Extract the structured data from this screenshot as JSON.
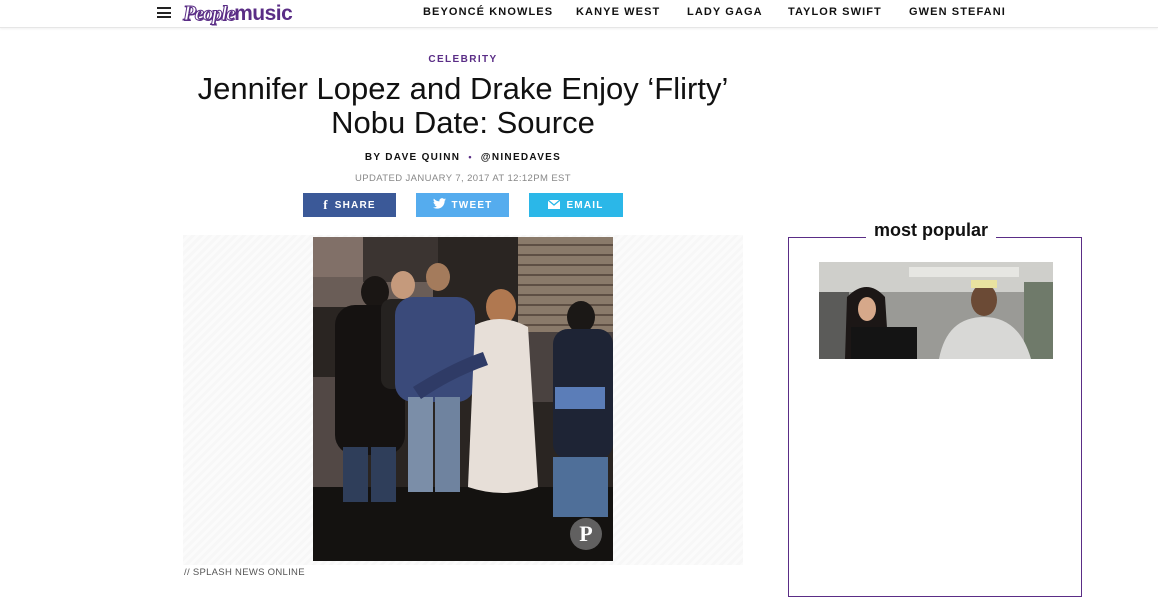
{
  "header": {
    "logo_people": "People",
    "logo_music": "music",
    "nav": [
      {
        "label": "BEYONCÉ KNOWLES"
      },
      {
        "label": "KANYE WEST"
      },
      {
        "label": "LADY GAGA"
      },
      {
        "label": "TAYLOR SWIFT"
      },
      {
        "label": "GWEN STEFANI"
      }
    ]
  },
  "article": {
    "kicker": "CELEBRITY",
    "title_line1": "Jennifer Lopez and Drake Enjoy ‘Flirty’",
    "title_line2": "Nobu Date: Source",
    "byline": {
      "author": "BY DAVE QUINN",
      "separator": "•",
      "handle": "@NINEDAVES"
    },
    "updated": "UPDATED JANUARY 7, 2017 AT 12:12PM EST",
    "share": [
      {
        "label": "SHARE",
        "icon": "facebook-icon",
        "color": "#3b5998"
      },
      {
        "label": "TWEET",
        "icon": "twitter-icon",
        "color": "#55acee"
      },
      {
        "label": "EMAIL",
        "icon": "email-icon",
        "color": "#2bb7e8"
      }
    ],
    "pinterest_icon": "pinterest-icon",
    "photo_credit": "// SPLASH NEWS ONLINE"
  },
  "sidebar": {
    "title": "most popular"
  },
  "colors": {
    "brand_purple": "#5a2d86",
    "facebook": "#3b5998",
    "twitter": "#55acee",
    "email": "#2bb7e8"
  }
}
